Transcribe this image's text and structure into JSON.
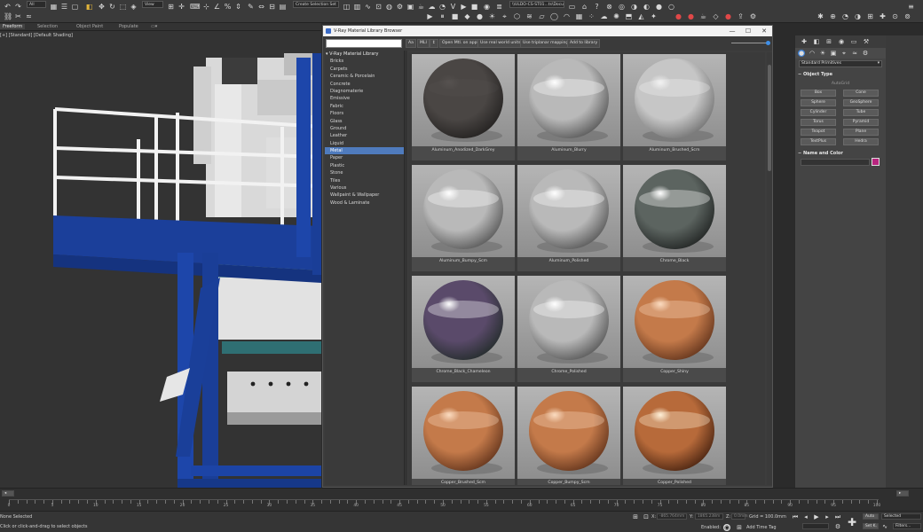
{
  "toolbar": {
    "selection_set_placeholder": "Create Selection Set",
    "view_dropdown": "View",
    "all_dropdown": "All",
    "path_field": "\\\\ULDO-CS-ST01...ts\\Document"
  },
  "tabs": [
    {
      "label": "Freeform"
    },
    {
      "label": "Selection"
    },
    {
      "label": "Object Paint"
    },
    {
      "label": "Populate"
    }
  ],
  "viewport": {
    "label": "[+] [Standard] [Default Shading]"
  },
  "browser": {
    "title": "V-Ray Material Library Browser",
    "toolbar": {
      "aa": "Aa",
      "mli": "MLI",
      "sort": "↕",
      "open_mtl": "Open Mtl. on apply",
      "real_world": "Use real world units",
      "triplanar": "Use triplanar mapping",
      "add_library": "Add to library"
    },
    "tree_root": "V-Ray Material Library",
    "categories": [
      "Bricks",
      "Carpets",
      "Ceramic & Porcelain",
      "Concrete",
      "Diagnomaterie",
      "Emissive",
      "Fabric",
      "Floors",
      "Glass",
      "Ground",
      "Leather",
      "Liquid",
      "Metal",
      "Paper",
      "Plastic",
      "Stone",
      "Tiles",
      "Various",
      "Wallpaint & Wallpaper",
      "Wood & Laminate"
    ],
    "selected_category": "Metal",
    "materials": [
      {
        "name": "Aluminum_Anodized_DarkGrey",
        "kind": "dark"
      },
      {
        "name": "Aluminum_Blurry",
        "kind": "chrome"
      },
      {
        "name": "Aluminum_Brushed_Scm",
        "kind": "brushed"
      },
      {
        "name": "Aluminum_Bumpy_Scm",
        "kind": "chrome"
      },
      {
        "name": "Aluminum_Polished",
        "kind": "chrome"
      },
      {
        "name": "Chrome_Black",
        "kind": "darkchrome"
      },
      {
        "name": "Chrome_Black_Chameleon",
        "kind": "chameleon"
      },
      {
        "name": "Chrome_Polished",
        "kind": "chrome"
      },
      {
        "name": "Copper_Shiny",
        "kind": "copper"
      },
      {
        "name": "Copper_Brushed_Scm",
        "kind": "copper"
      },
      {
        "name": "Copper_Bumpy_Scm",
        "kind": "copper"
      },
      {
        "name": "Copper_Polished",
        "kind": "copperdark"
      }
    ]
  },
  "command_panel": {
    "category_dropdown": "Standard Primitives",
    "object_type_title": "Object Type",
    "autogrid": "AutoGrid",
    "buttons": [
      "Box",
      "Cone",
      "Sphere",
      "GeoSphere",
      "Cylinder",
      "Tube",
      "Torus",
      "Pyramid",
      "Teapot",
      "Plane",
      "TextPlus",
      "Hedra"
    ],
    "name_color_title": "Name and Color",
    "color": "#b8257f"
  },
  "timeline": {
    "frame_display": "0 / 100",
    "ticks": [
      0,
      5,
      10,
      15,
      20,
      25,
      30,
      35,
      40,
      45,
      50,
      55,
      60,
      65,
      70,
      75,
      80,
      85,
      90,
      95,
      100
    ]
  },
  "status": {
    "selection": "None Selected",
    "prompt": "Click or click-and-drag to select objects",
    "x_label": "X:",
    "x_value": "-865.764mm",
    "y_label": "Y:",
    "y_value": "1865.238m",
    "z_label": "Z:",
    "z_value": "0.0mm",
    "grid": "Grid = 100.0mm",
    "enabled": "Enabled:",
    "add_time_tag": "Add Time Tag",
    "auto": "Auto",
    "selected": "Selected",
    "set_k": "Set K.",
    "filters": "Filters..."
  }
}
